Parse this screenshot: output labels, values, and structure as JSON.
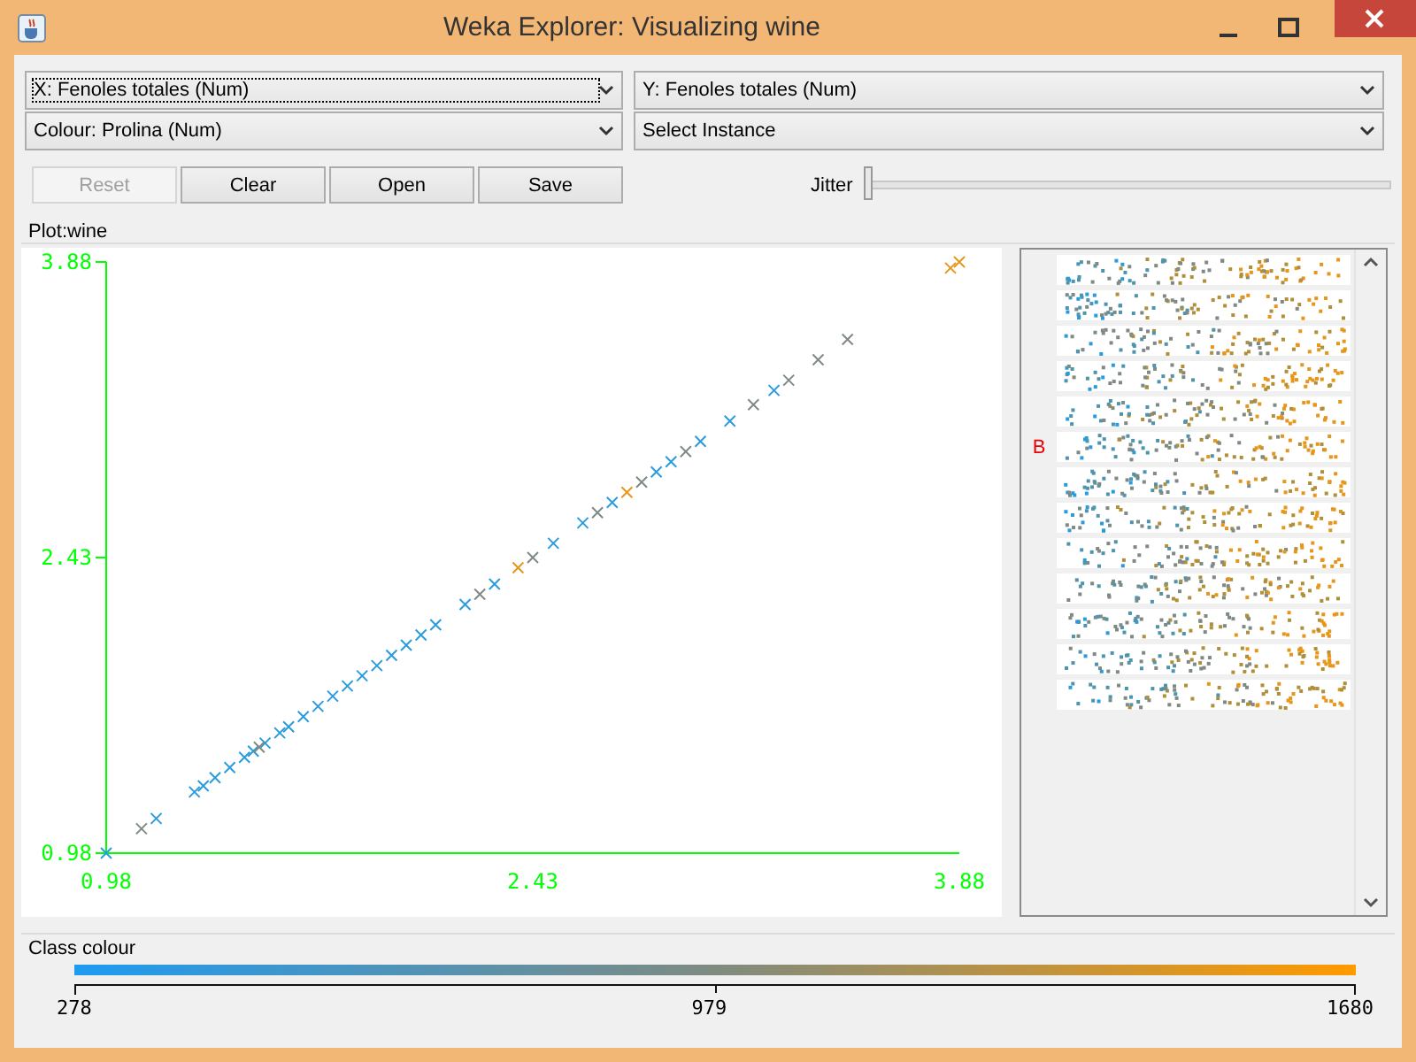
{
  "window": {
    "title": "Weka Explorer: Visualizing wine"
  },
  "selectors": [
    {
      "label": "X: Fenoles totales (Num)",
      "focused": true
    },
    {
      "label": "Y: Fenoles totales (Num)",
      "focused": false
    },
    {
      "label": "Colour: Prolina (Num)",
      "focused": false
    },
    {
      "label": "Select Instance",
      "focused": false
    }
  ],
  "buttons": [
    {
      "label": "Reset",
      "disabled": true
    },
    {
      "label": "Clear",
      "disabled": false
    },
    {
      "label": "Open",
      "disabled": false
    },
    {
      "label": "Save",
      "disabled": false
    }
  ],
  "jitter": {
    "label": "Jitter",
    "level": 0
  },
  "plot": {
    "title": "Plot:wine",
    "chart_data": {
      "type": "scatter",
      "x": [
        0.98,
        1.1,
        1.15,
        1.28,
        1.31,
        1.35,
        1.4,
        1.45,
        1.48,
        1.5,
        1.52,
        1.57,
        1.6,
        1.65,
        1.7,
        1.75,
        1.8,
        1.85,
        1.9,
        1.95,
        2.0,
        2.05,
        2.1,
        2.2,
        2.25,
        2.3,
        2.38,
        2.43,
        2.5,
        2.6,
        2.65,
        2.7,
        2.75,
        2.8,
        2.85,
        2.9,
        2.95,
        3.0,
        3.1,
        3.18,
        3.25,
        3.3,
        3.4,
        3.5,
        3.85,
        3.88
      ],
      "series": [
        {
          "color": "#2a9bdc",
          "values": [
            0.98,
            null,
            1.15,
            1.28,
            1.31,
            1.35,
            1.4,
            1.45,
            1.48,
            null,
            1.52,
            1.57,
            1.6,
            1.65,
            1.7,
            1.75,
            1.8,
            1.85,
            1.9,
            1.95,
            2.0,
            2.05,
            2.1,
            2.2,
            null,
            2.3,
            null,
            null,
            2.5,
            2.6,
            null,
            2.7,
            null,
            null,
            2.85,
            2.9,
            null,
            3.0,
            3.1,
            null,
            3.25,
            null,
            null,
            null,
            null,
            null
          ]
        },
        {
          "color": "#7f8a84",
          "values": [
            null,
            1.1,
            null,
            null,
            null,
            null,
            null,
            null,
            null,
            1.5,
            null,
            null,
            null,
            null,
            null,
            null,
            null,
            null,
            null,
            null,
            null,
            null,
            null,
            null,
            2.25,
            null,
            null,
            2.43,
            null,
            null,
            2.65,
            null,
            null,
            2.8,
            null,
            null,
            2.95,
            null,
            null,
            3.18,
            null,
            3.3,
            3.4,
            3.5,
            null,
            null
          ]
        },
        {
          "color": "#e7961c",
          "values": [
            null,
            null,
            null,
            null,
            null,
            null,
            null,
            null,
            null,
            null,
            null,
            null,
            null,
            null,
            null,
            null,
            null,
            null,
            null,
            null,
            null,
            null,
            null,
            null,
            null,
            null,
            2.38,
            null,
            null,
            null,
            null,
            null,
            2.75,
            null,
            null,
            null,
            null,
            null,
            null,
            null,
            null,
            null,
            null,
            null,
            3.85,
            3.88
          ]
        }
      ],
      "xlim": [
        0.98,
        3.88
      ],
      "ylim": [
        0.98,
        3.88
      ],
      "xticks": [
        0.98,
        2.43,
        3.88
      ],
      "yticks": [
        0.98,
        2.43,
        3.88
      ]
    }
  },
  "attribute_panel": {
    "marker": "B"
  },
  "class_colour": {
    "title": "Class colour",
    "ticks": [
      "278",
      "979",
      "1680"
    ]
  }
}
